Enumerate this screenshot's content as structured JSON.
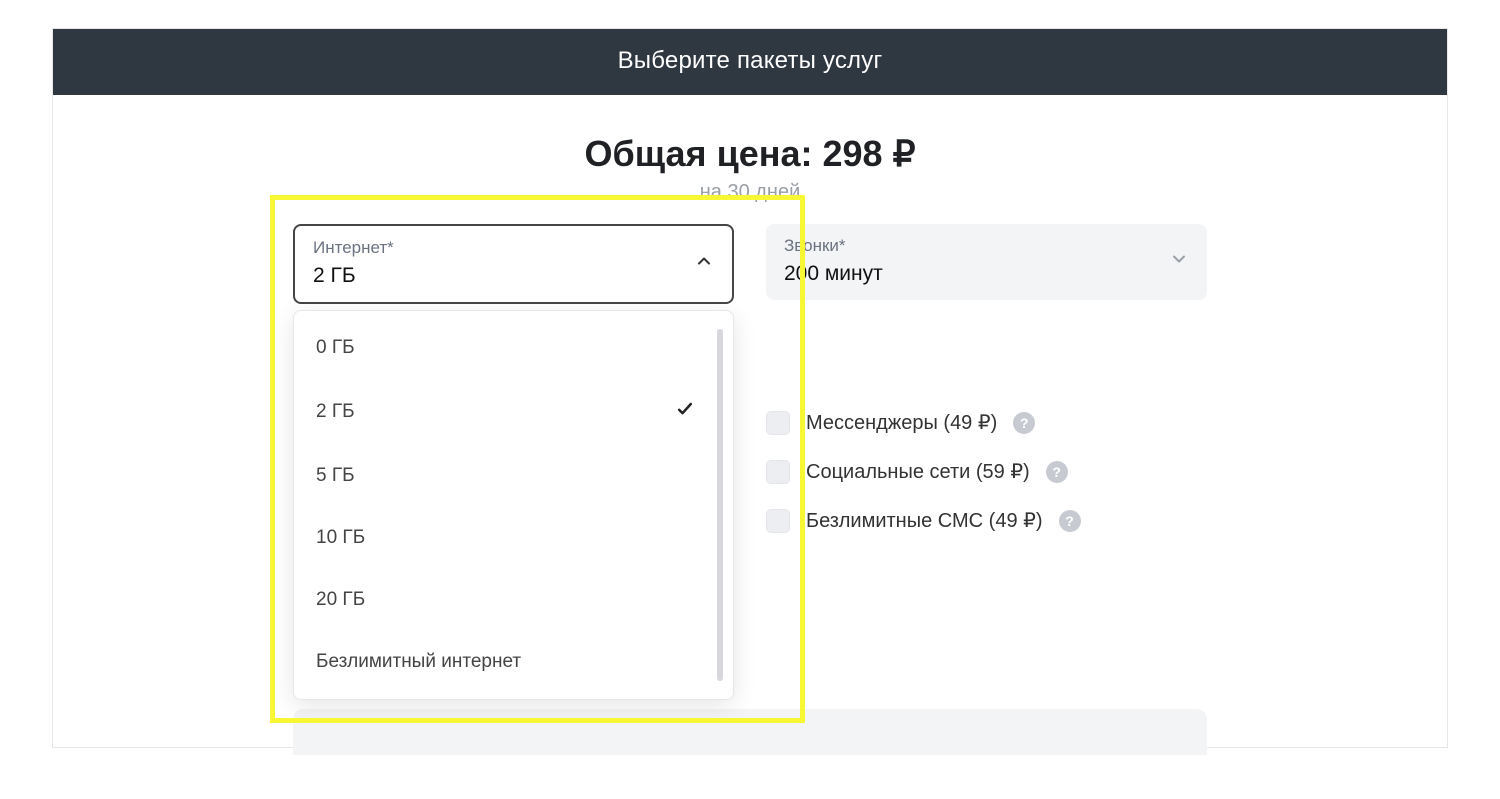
{
  "header": {
    "title": "Выберите пакеты услуг"
  },
  "price": {
    "label": "Общая цена:",
    "amount": "298",
    "currency": "₽",
    "sub": "на 30 дней"
  },
  "internet": {
    "label": "Интернет*",
    "value": "2 ГБ",
    "options": [
      "0 ГБ",
      "2 ГБ",
      "5 ГБ",
      "10 ГБ",
      "20 ГБ",
      "Безлимитный интернет"
    ],
    "selected_option": "2 ГБ"
  },
  "calls": {
    "label": "Звонки*",
    "value": "200 минут"
  },
  "addons": [
    {
      "label": "Мессенджеры (49 ₽)"
    },
    {
      "label": "Социальные сети (59 ₽)"
    },
    {
      "label": "Безлимитные СМС (49 ₽)"
    }
  ],
  "highlight_color": "#f7f733"
}
